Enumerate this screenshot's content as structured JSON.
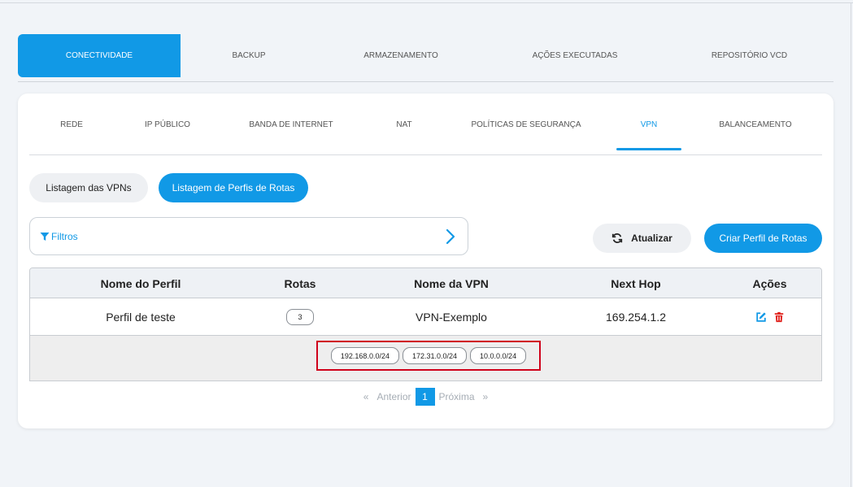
{
  "main_tabs": [
    {
      "label": "CONECTIVIDADE",
      "active": true
    },
    {
      "label": "BACKUP"
    },
    {
      "label": "ARMAZENAMENTO"
    },
    {
      "label": "AÇÕES EXECUTADAS"
    },
    {
      "label": "REPOSITÓRIO VCD"
    }
  ],
  "sub_tabs": [
    {
      "label": "REDE"
    },
    {
      "label": "IP PÚBLICO"
    },
    {
      "label": "BANDA DE INTERNET"
    },
    {
      "label": "NAT"
    },
    {
      "label": "POLÍTICAS DE SEGURANÇA"
    },
    {
      "label": "VPN",
      "active": true
    },
    {
      "label": "BALANCEAMENTO"
    }
  ],
  "view_toggle": {
    "list_vpns": "Listagem das VPNs",
    "list_profiles": "Listagem de Perfis de Rotas"
  },
  "filter": {
    "label": "Filtros"
  },
  "actions": {
    "refresh": "Atualizar",
    "create": "Criar Perfil de Rotas"
  },
  "table": {
    "headers": [
      "Nome do Perfil",
      "Rotas",
      "Nome da VPN",
      "Next Hop",
      "Ações"
    ],
    "rows": [
      {
        "profile_name": "Perfil de teste",
        "routes_count": "3",
        "vpn_name": "VPN-Exemplo",
        "next_hop": "169.254.1.2",
        "routes": [
          "192.168.0.0/24",
          "172.31.0.0/24",
          "10.0.0.0/24"
        ]
      }
    ]
  },
  "pagination": {
    "prev_symbol": "«",
    "prev": "Anterior",
    "current": "1",
    "next": "Próxima",
    "next_symbol": "»"
  },
  "colors": {
    "accent": "#1199e6",
    "delete": "#e0201b",
    "highlight_border": "#d0021b"
  },
  "icons": {
    "filter": "filter-icon",
    "chevron": "chevron-right-icon",
    "refresh": "refresh-icon",
    "edit": "edit-icon",
    "delete": "trash-icon"
  }
}
